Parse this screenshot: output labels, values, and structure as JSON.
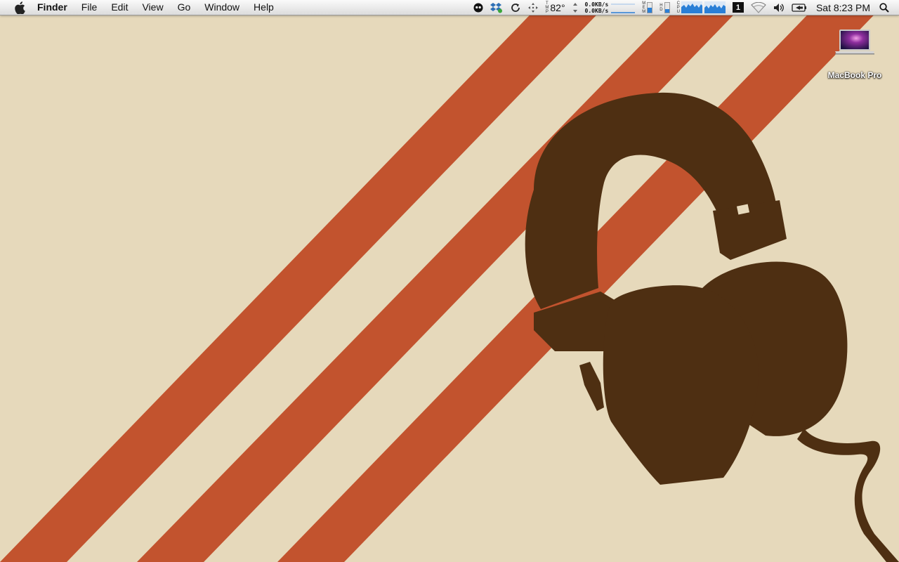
{
  "menubar": {
    "app_name": "Finder",
    "menus": [
      "File",
      "Edit",
      "View",
      "Go",
      "Window",
      "Help"
    ],
    "status": {
      "temperature": "82°",
      "temp_label": [
        "T",
        "M",
        "P"
      ],
      "net_up": "0.0KB/s",
      "net_down": "0.0KB/s",
      "mem_label": [
        "M",
        "E",
        "M"
      ],
      "hd_label": [
        "H",
        "D"
      ],
      "cpu_label": [
        "C",
        "P",
        "U"
      ],
      "mem_fill": 0.45,
      "hd_fill": 0.35,
      "space_number": "1",
      "clock": "Sat 8:23 PM"
    }
  },
  "desktop": {
    "icons": [
      {
        "label": "MacBook Pro"
      }
    ],
    "colors": {
      "background": "#e6d9bb",
      "stripe": "#c2532e",
      "headphones": "#4e2f12"
    }
  }
}
